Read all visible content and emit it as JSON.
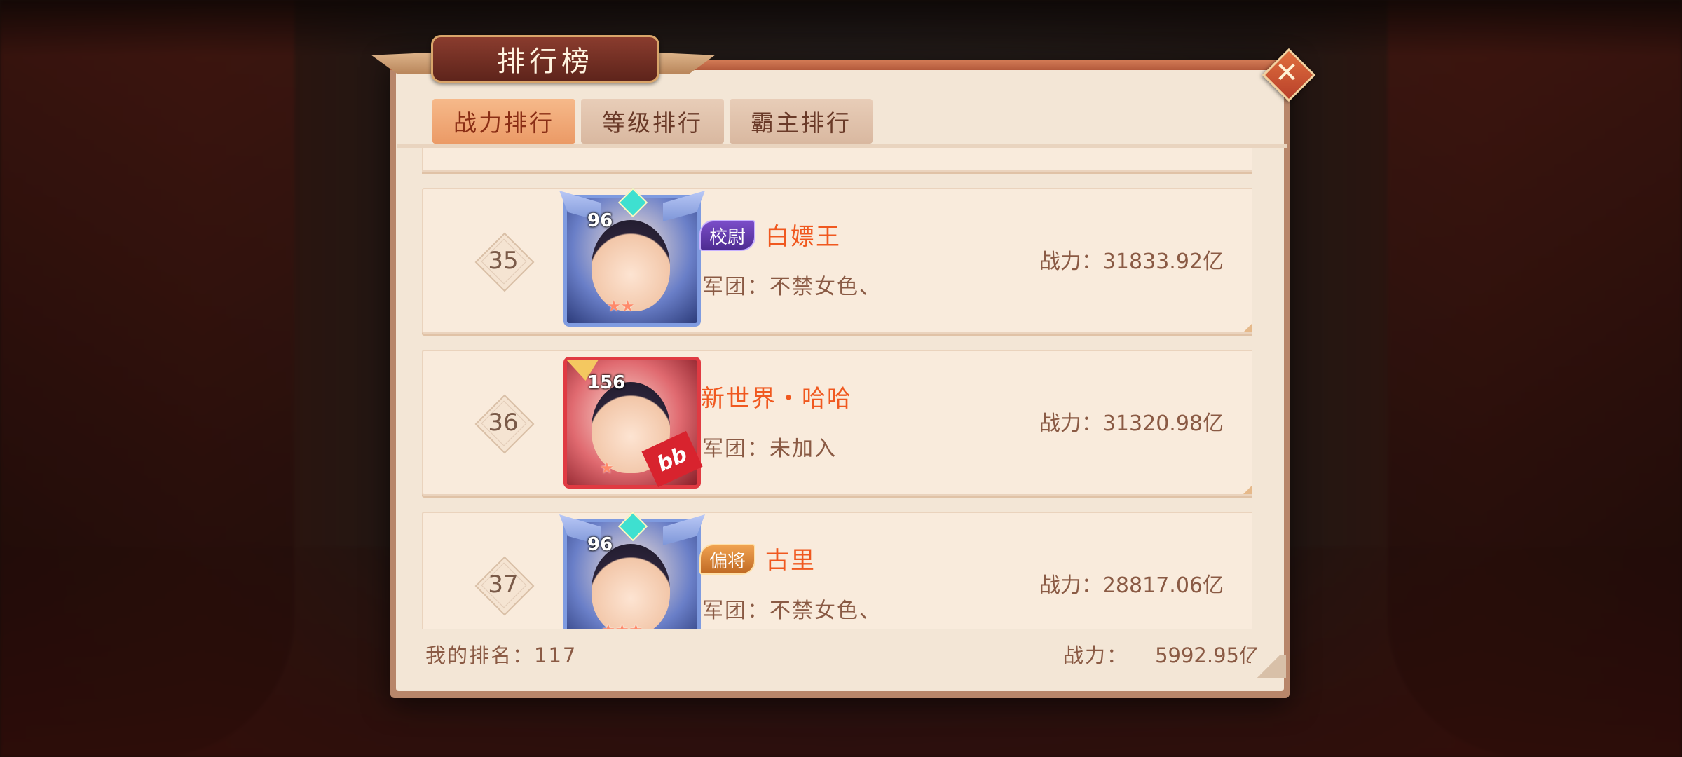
{
  "dialog": {
    "title": "排行榜",
    "close_label": "✕"
  },
  "tabs": [
    {
      "label": "战力排行",
      "active": true
    },
    {
      "label": "等级排行",
      "active": false
    },
    {
      "label": "霸主排行",
      "active": false
    }
  ],
  "rows": [
    {
      "rank": "35",
      "level": "96",
      "title_badge": "校尉",
      "name": "白嫖王",
      "guild": "军团：不禁女色、",
      "power": "战力：31833.92亿"
    },
    {
      "rank": "36",
      "level": "156",
      "badge_text": "bb",
      "title_badge": "",
      "name": "新世界・哈哈",
      "guild": "军团：未加入",
      "power": "战力：31320.98亿"
    },
    {
      "rank": "37",
      "level": "96",
      "title_badge": "偏将",
      "name": "古里",
      "guild": "军团：不禁女色、",
      "power": "战力：28817.06亿"
    }
  ],
  "footer": {
    "my_rank": "我的排名：117",
    "my_power_label": "战力：",
    "my_power_value": "5992.95亿"
  },
  "colors": {
    "accent": "#f0581f",
    "tab_active": "#eb9a66",
    "panel": "#f3e6d6"
  }
}
